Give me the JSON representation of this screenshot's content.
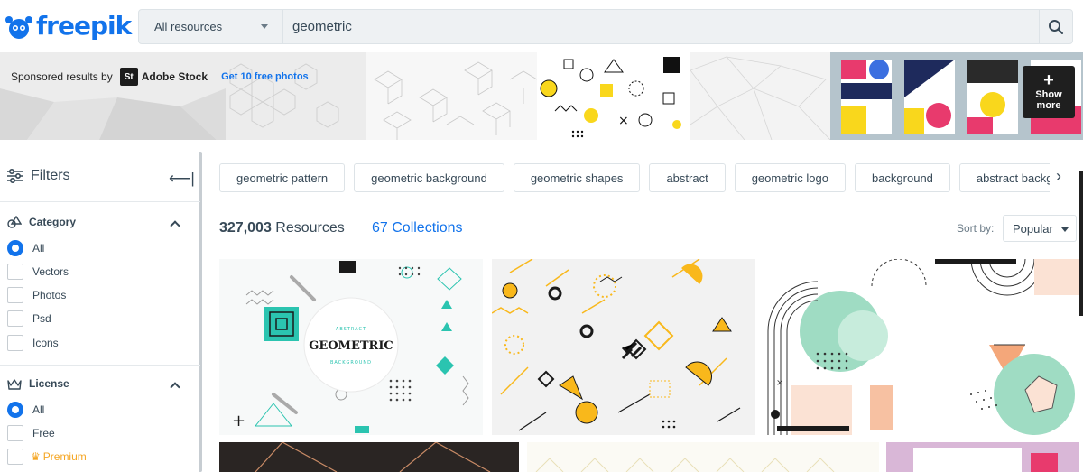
{
  "header": {
    "logo_text": "freepik",
    "search_scope": "All resources",
    "search_query": "geometric"
  },
  "sponsored": {
    "label": "Sponsored results by",
    "badge": "St",
    "brand": "Adobe Stock",
    "link": "Get 10 free photos",
    "show_more_line1": "Show",
    "show_more_line2": "more"
  },
  "sidebar": {
    "title": "Filters",
    "category": {
      "title": "Category",
      "options": [
        "All",
        "Vectors",
        "Photos",
        "Psd",
        "Icons"
      ],
      "selected": "All"
    },
    "license": {
      "title": "License",
      "options": [
        "All",
        "Free",
        "Premium"
      ],
      "selected": "All"
    }
  },
  "main": {
    "tags": [
      "geometric pattern",
      "geometric background",
      "geometric shapes",
      "abstract",
      "geometric logo",
      "background",
      "abstract backg"
    ],
    "results_count": "327,003",
    "results_label": "Resources",
    "collections": "67 Collections",
    "sort_label": "Sort by:",
    "sort_value": "Popular",
    "thumb1_title_top": "ABSTRACT",
    "thumb1_title_main": "GEOMETRIC",
    "thumb1_title_bottom": "BACKGROUND"
  },
  "colors": {
    "brand": "#1273eb",
    "accent_teal": "#2bc4b0",
    "accent_yellow": "#f9b81b"
  }
}
